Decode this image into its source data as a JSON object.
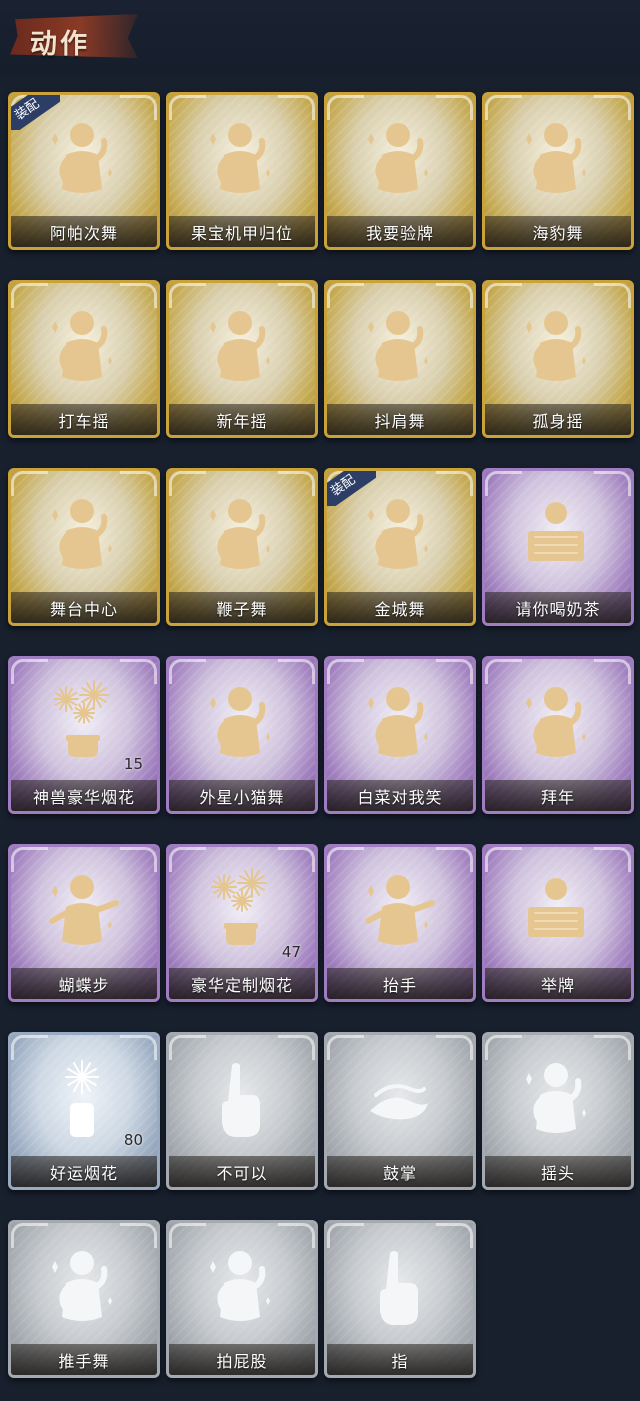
{
  "header": {
    "title": "动作"
  },
  "equipped_badge": "装配",
  "cards": [
    {
      "label": "阿帕次舞",
      "rarity": "gold",
      "equipped": true,
      "count": "",
      "icon": "dance-figure-icon"
    },
    {
      "label": "果宝机甲归位",
      "rarity": "gold",
      "equipped": false,
      "count": "",
      "icon": "dance-figure-icon"
    },
    {
      "label": "我要验牌",
      "rarity": "gold",
      "equipped": false,
      "count": "",
      "icon": "cards-figure-icon"
    },
    {
      "label": "海豹舞",
      "rarity": "gold",
      "equipped": false,
      "count": "",
      "icon": "dance-figure-icon"
    },
    {
      "label": "打车摇",
      "rarity": "gold",
      "equipped": false,
      "count": "",
      "icon": "dance-figure-icon"
    },
    {
      "label": "新年摇",
      "rarity": "gold",
      "equipped": false,
      "count": "",
      "icon": "dance-figure-icon"
    },
    {
      "label": "抖肩舞",
      "rarity": "gold",
      "equipped": false,
      "count": "",
      "icon": "dance-figure-icon"
    },
    {
      "label": "孤身摇",
      "rarity": "gold",
      "equipped": false,
      "count": "",
      "icon": "dance-figure-icon"
    },
    {
      "label": "舞台中心",
      "rarity": "gold",
      "equipped": false,
      "count": "",
      "icon": "dance-figure-icon"
    },
    {
      "label": "鞭子舞",
      "rarity": "gold",
      "equipped": false,
      "count": "",
      "icon": "dance-figure-icon"
    },
    {
      "label": "金城舞",
      "rarity": "gold",
      "equipped": true,
      "count": "",
      "icon": "wave-figure-icon"
    },
    {
      "label": "请你喝奶茶",
      "rarity": "purple",
      "equipped": false,
      "count": "",
      "icon": "sign-figure-icon"
    },
    {
      "label": "神兽豪华烟花",
      "rarity": "purple",
      "equipped": false,
      "count": "15",
      "icon": "firework-icon"
    },
    {
      "label": "外星小猫舞",
      "rarity": "purple",
      "equipped": false,
      "count": "",
      "icon": "dance-figure-icon"
    },
    {
      "label": "白菜对我笑",
      "rarity": "purple",
      "equipped": false,
      "count": "",
      "icon": "dance-figure-icon"
    },
    {
      "label": "拜年",
      "rarity": "purple",
      "equipped": false,
      "count": "",
      "icon": "bow-figure-icon"
    },
    {
      "label": "蝴蝶步",
      "rarity": "purple",
      "equipped": false,
      "count": "",
      "icon": "point-figure-icon"
    },
    {
      "label": "豪华定制烟花",
      "rarity": "purple",
      "equipped": false,
      "count": "47",
      "icon": "firework-icon"
    },
    {
      "label": "抬手",
      "rarity": "purple",
      "equipped": false,
      "count": "",
      "icon": "raise-hand-icon"
    },
    {
      "label": "举牌",
      "rarity": "purple",
      "equipped": false,
      "count": "",
      "icon": "sign-figure-icon"
    },
    {
      "label": "好运烟花",
      "rarity": "blue",
      "equipped": false,
      "count": "80",
      "icon": "firework-can-icon"
    },
    {
      "label": "不可以",
      "rarity": "gray",
      "equipped": false,
      "count": "",
      "icon": "finger-wag-icon"
    },
    {
      "label": "鼓掌",
      "rarity": "gray",
      "equipped": false,
      "count": "",
      "icon": "clap-icon"
    },
    {
      "label": "摇头",
      "rarity": "gray",
      "equipped": false,
      "count": "",
      "icon": "shake-head-icon"
    },
    {
      "label": "推手舞",
      "rarity": "gray",
      "equipped": false,
      "count": "",
      "icon": "push-dance-icon"
    },
    {
      "label": "拍屁股",
      "rarity": "gray",
      "equipped": false,
      "count": "",
      "icon": "slap-icon"
    },
    {
      "label": "指",
      "rarity": "gray",
      "equipped": false,
      "count": "",
      "icon": "point-hand-icon"
    }
  ],
  "colors": {
    "background": "#18202e",
    "gold": "#c9a33a",
    "purple": "#a07dc0",
    "blue": "#9aaac0",
    "gray": "#a5aab0",
    "badge": "#2c3d66",
    "title_banner": "#7a3322"
  }
}
